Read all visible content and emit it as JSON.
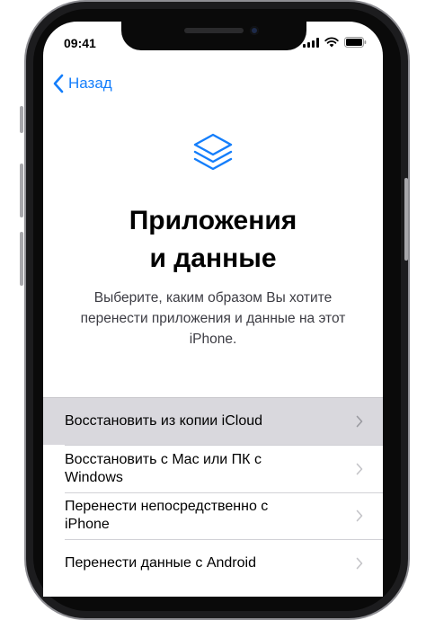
{
  "status_bar": {
    "time": "09:41"
  },
  "nav": {
    "back_label": "Назад"
  },
  "header": {
    "title_line1": "Приложения",
    "title_line2": "и данные",
    "subtitle": "Выберите, каким образом Вы хотите перенести приложения и данные на этот iPhone."
  },
  "options": [
    {
      "label": "Восстановить из копии iCloud",
      "selected": true
    },
    {
      "label": "Восстановить с Mac или ПК с Windows",
      "selected": false
    },
    {
      "label": "Перенести непосредственно с iPhone",
      "selected": false
    },
    {
      "label": "Перенести данные с Android",
      "selected": false
    }
  ],
  "icons": {
    "header_icon": "layers-icon",
    "back": "chevron-left-icon",
    "row_arrow": "chevron-right-icon"
  },
  "colors": {
    "accent": "#147efb",
    "selected_row": "#d9d8dd",
    "phone_frame": "#1c1c1e"
  }
}
